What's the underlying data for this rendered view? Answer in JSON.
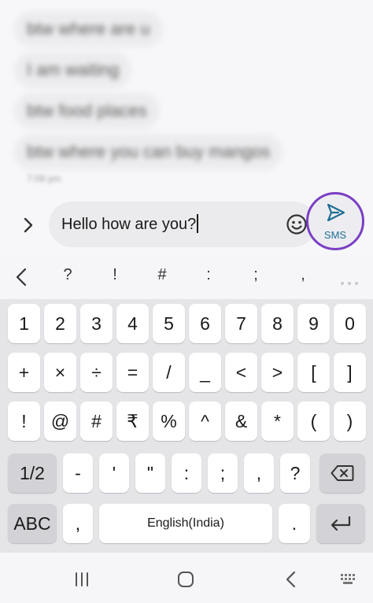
{
  "conversation": {
    "messages": [
      {
        "text": "btw where are u"
      },
      {
        "text": "I am waiting"
      },
      {
        "text": "btw food places"
      },
      {
        "text": "btw where you can buy mangos"
      }
    ],
    "meta": "7:09 pm"
  },
  "composer": {
    "text": "Hello how are you?",
    "send_label": "SMS",
    "send_ring_color": "#7b3fc4",
    "send_icon_color": "#1f6e93"
  },
  "symbol_strip": [
    "?",
    "!",
    "#",
    ":",
    ";",
    ","
  ],
  "keyboard": {
    "row1": [
      "1",
      "2",
      "3",
      "4",
      "5",
      "6",
      "7",
      "8",
      "9",
      "0"
    ],
    "row2": [
      "+",
      "×",
      "÷",
      "=",
      "/",
      "_",
      "<",
      ">",
      "[",
      "]"
    ],
    "row3": [
      "!",
      "@",
      "#",
      "₹",
      "%",
      "^",
      "&",
      "*",
      "(",
      ")"
    ],
    "row4": [
      "1/2",
      "-",
      "'",
      "\"",
      ":",
      ";",
      ",",
      "?"
    ],
    "row5": {
      "abc": "ABC",
      "comma": ",",
      "space": "English(India)",
      "period": "."
    }
  }
}
